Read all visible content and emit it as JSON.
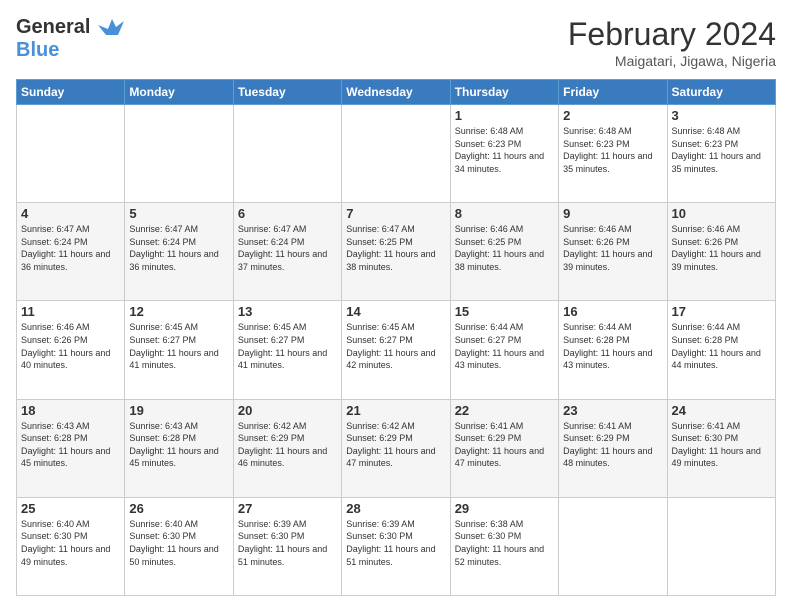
{
  "logo": {
    "line1": "General",
    "line2": "Blue"
  },
  "title": "February 2024",
  "location": "Maigatari, Jigawa, Nigeria",
  "days_of_week": [
    "Sunday",
    "Monday",
    "Tuesday",
    "Wednesday",
    "Thursday",
    "Friday",
    "Saturday"
  ],
  "weeks": [
    [
      {
        "day": "",
        "info": ""
      },
      {
        "day": "",
        "info": ""
      },
      {
        "day": "",
        "info": ""
      },
      {
        "day": "",
        "info": ""
      },
      {
        "day": "1",
        "info": "Sunrise: 6:48 AM\nSunset: 6:23 PM\nDaylight: 11 hours\nand 34 minutes."
      },
      {
        "day": "2",
        "info": "Sunrise: 6:48 AM\nSunset: 6:23 PM\nDaylight: 11 hours\nand 35 minutes."
      },
      {
        "day": "3",
        "info": "Sunrise: 6:48 AM\nSunset: 6:23 PM\nDaylight: 11 hours\nand 35 minutes."
      }
    ],
    [
      {
        "day": "4",
        "info": "Sunrise: 6:47 AM\nSunset: 6:24 PM\nDaylight: 11 hours\nand 36 minutes."
      },
      {
        "day": "5",
        "info": "Sunrise: 6:47 AM\nSunset: 6:24 PM\nDaylight: 11 hours\nand 36 minutes."
      },
      {
        "day": "6",
        "info": "Sunrise: 6:47 AM\nSunset: 6:24 PM\nDaylight: 11 hours\nand 37 minutes."
      },
      {
        "day": "7",
        "info": "Sunrise: 6:47 AM\nSunset: 6:25 PM\nDaylight: 11 hours\nand 38 minutes."
      },
      {
        "day": "8",
        "info": "Sunrise: 6:46 AM\nSunset: 6:25 PM\nDaylight: 11 hours\nand 38 minutes."
      },
      {
        "day": "9",
        "info": "Sunrise: 6:46 AM\nSunset: 6:26 PM\nDaylight: 11 hours\nand 39 minutes."
      },
      {
        "day": "10",
        "info": "Sunrise: 6:46 AM\nSunset: 6:26 PM\nDaylight: 11 hours\nand 39 minutes."
      }
    ],
    [
      {
        "day": "11",
        "info": "Sunrise: 6:46 AM\nSunset: 6:26 PM\nDaylight: 11 hours\nand 40 minutes."
      },
      {
        "day": "12",
        "info": "Sunrise: 6:45 AM\nSunset: 6:27 PM\nDaylight: 11 hours\nand 41 minutes."
      },
      {
        "day": "13",
        "info": "Sunrise: 6:45 AM\nSunset: 6:27 PM\nDaylight: 11 hours\nand 41 minutes."
      },
      {
        "day": "14",
        "info": "Sunrise: 6:45 AM\nSunset: 6:27 PM\nDaylight: 11 hours\nand 42 minutes."
      },
      {
        "day": "15",
        "info": "Sunrise: 6:44 AM\nSunset: 6:27 PM\nDaylight: 11 hours\nand 43 minutes."
      },
      {
        "day": "16",
        "info": "Sunrise: 6:44 AM\nSunset: 6:28 PM\nDaylight: 11 hours\nand 43 minutes."
      },
      {
        "day": "17",
        "info": "Sunrise: 6:44 AM\nSunset: 6:28 PM\nDaylight: 11 hours\nand 44 minutes."
      }
    ],
    [
      {
        "day": "18",
        "info": "Sunrise: 6:43 AM\nSunset: 6:28 PM\nDaylight: 11 hours\nand 45 minutes."
      },
      {
        "day": "19",
        "info": "Sunrise: 6:43 AM\nSunset: 6:28 PM\nDaylight: 11 hours\nand 45 minutes."
      },
      {
        "day": "20",
        "info": "Sunrise: 6:42 AM\nSunset: 6:29 PM\nDaylight: 11 hours\nand 46 minutes."
      },
      {
        "day": "21",
        "info": "Sunrise: 6:42 AM\nSunset: 6:29 PM\nDaylight: 11 hours\nand 47 minutes."
      },
      {
        "day": "22",
        "info": "Sunrise: 6:41 AM\nSunset: 6:29 PM\nDaylight: 11 hours\nand 47 minutes."
      },
      {
        "day": "23",
        "info": "Sunrise: 6:41 AM\nSunset: 6:29 PM\nDaylight: 11 hours\nand 48 minutes."
      },
      {
        "day": "24",
        "info": "Sunrise: 6:41 AM\nSunset: 6:30 PM\nDaylight: 11 hours\nand 49 minutes."
      }
    ],
    [
      {
        "day": "25",
        "info": "Sunrise: 6:40 AM\nSunset: 6:30 PM\nDaylight: 11 hours\nand 49 minutes."
      },
      {
        "day": "26",
        "info": "Sunrise: 6:40 AM\nSunset: 6:30 PM\nDaylight: 11 hours\nand 50 minutes."
      },
      {
        "day": "27",
        "info": "Sunrise: 6:39 AM\nSunset: 6:30 PM\nDaylight: 11 hours\nand 51 minutes."
      },
      {
        "day": "28",
        "info": "Sunrise: 6:39 AM\nSunset: 6:30 PM\nDaylight: 11 hours\nand 51 minutes."
      },
      {
        "day": "29",
        "info": "Sunrise: 6:38 AM\nSunset: 6:30 PM\nDaylight: 11 hours\nand 52 minutes."
      },
      {
        "day": "",
        "info": ""
      },
      {
        "day": "",
        "info": ""
      }
    ]
  ]
}
